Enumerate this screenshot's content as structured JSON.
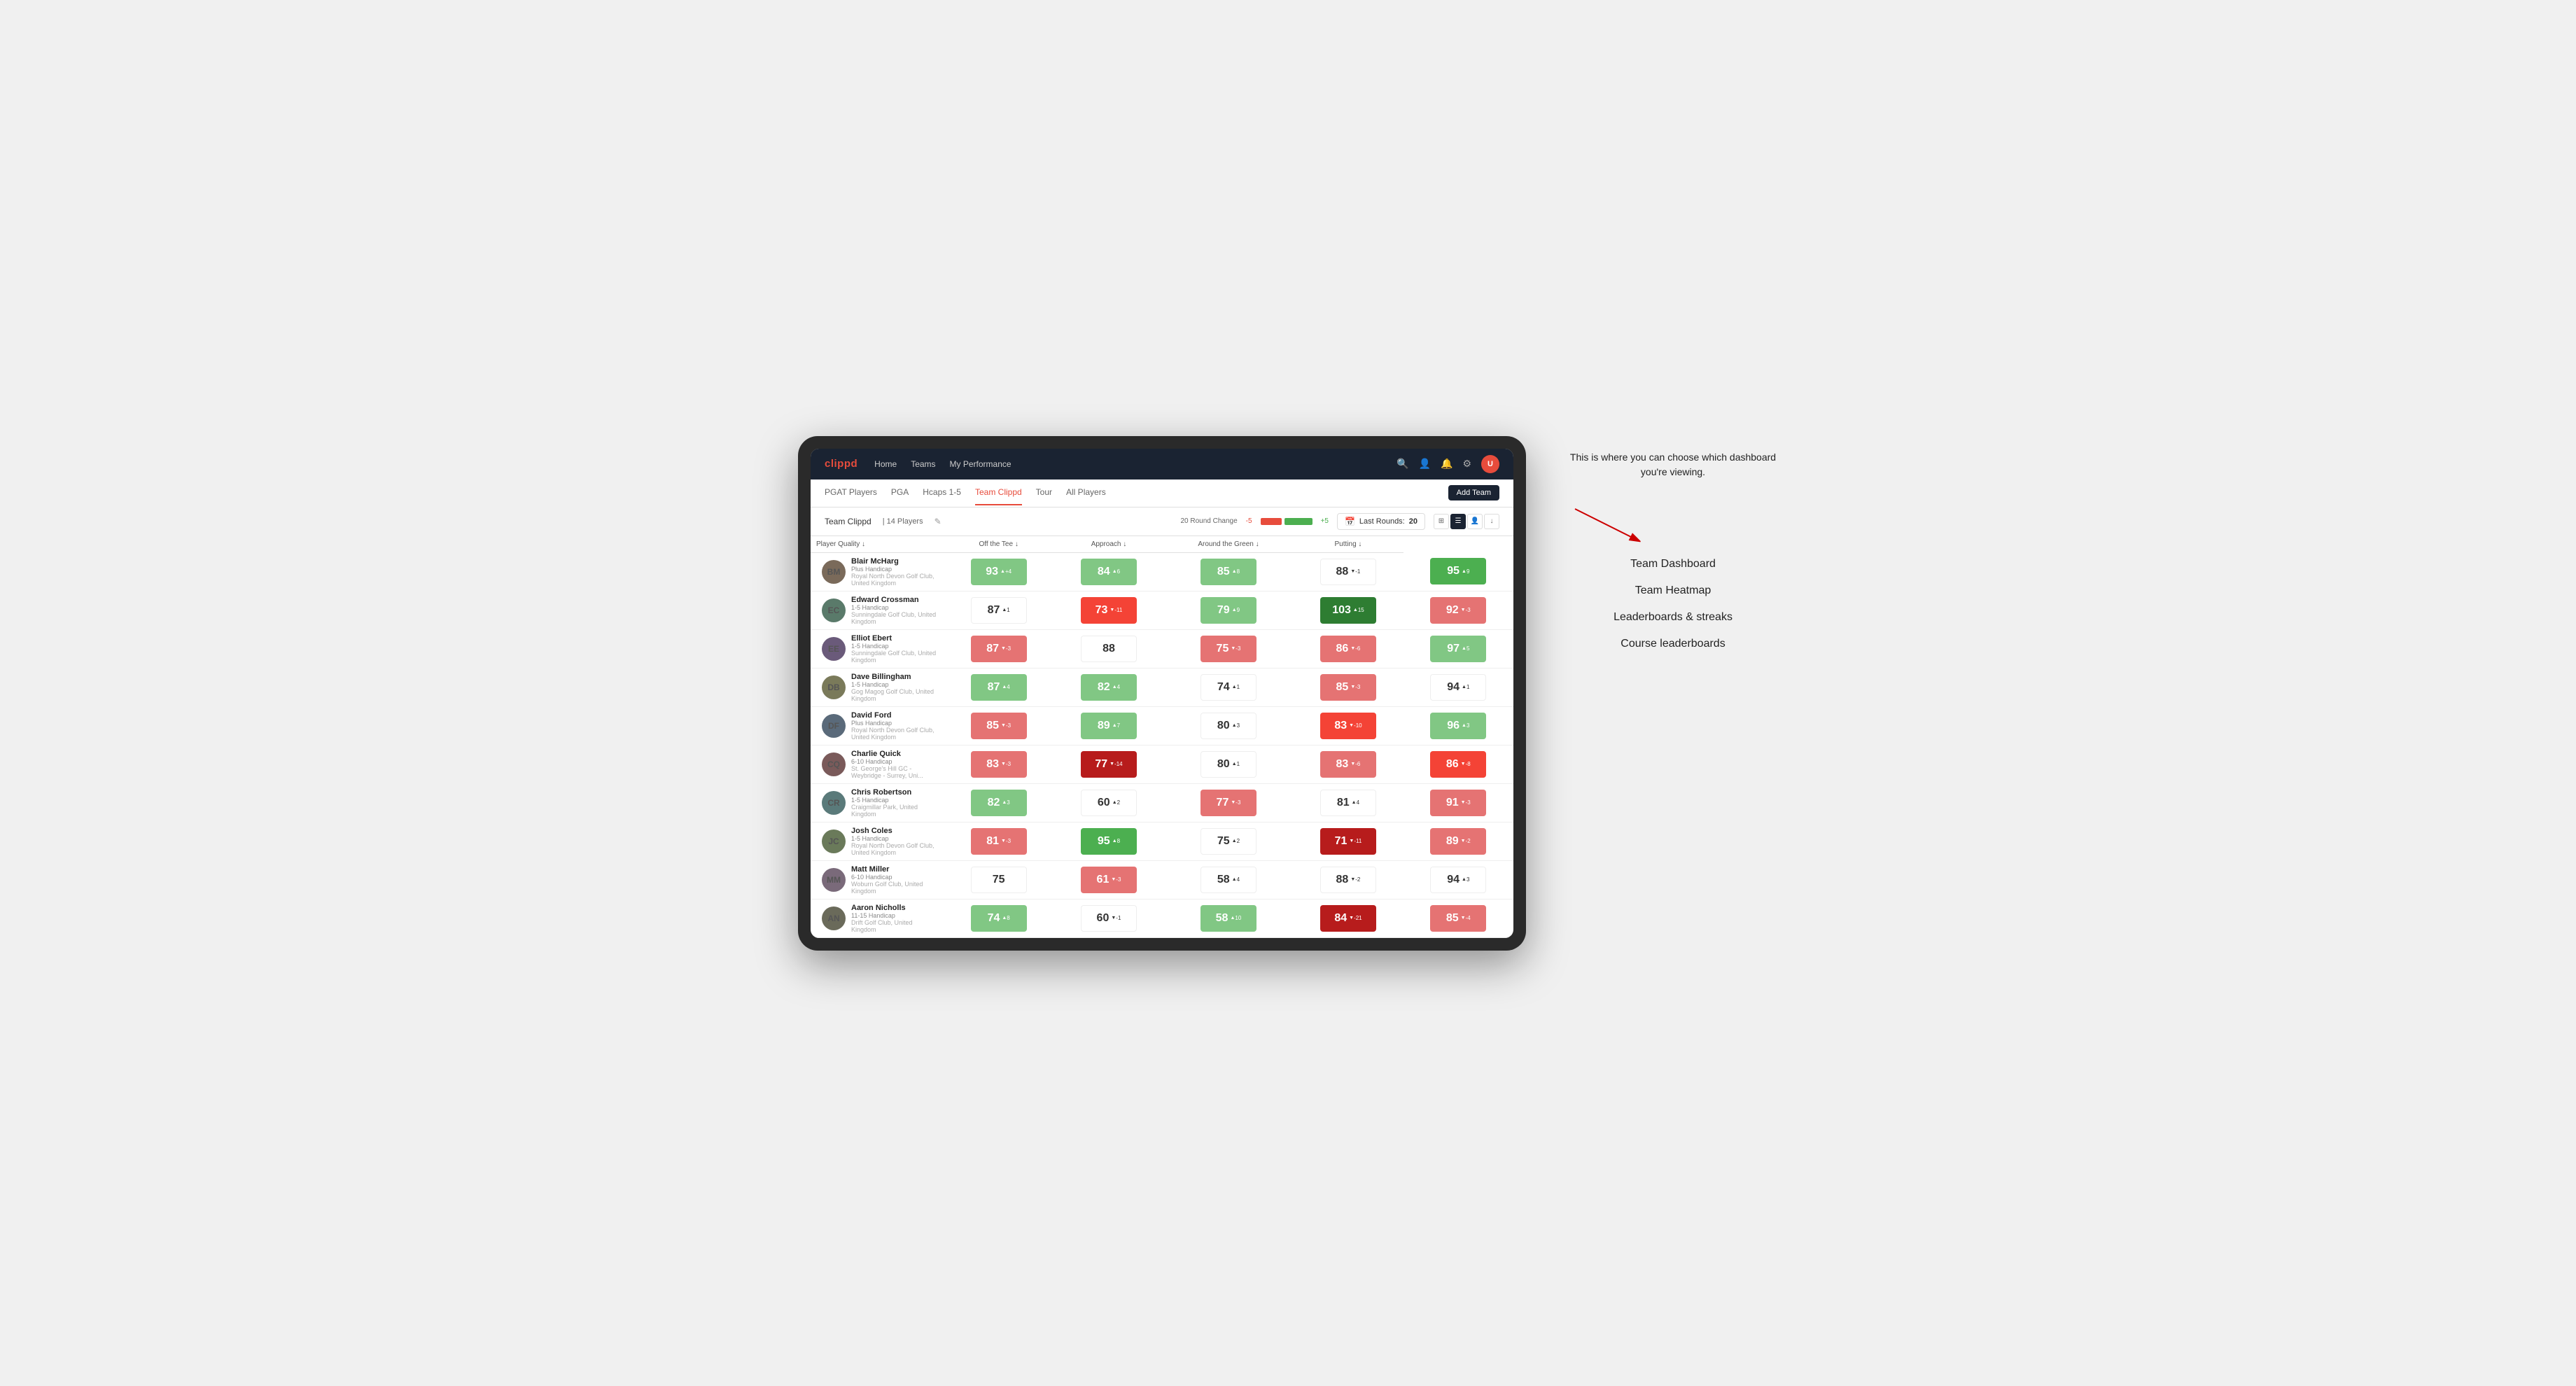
{
  "brand": "clippd",
  "navbar": {
    "links": [
      "Home",
      "Teams",
      "My Performance"
    ],
    "icons": [
      "search",
      "person",
      "bell",
      "settings",
      "avatar"
    ]
  },
  "subnav": {
    "tabs": [
      "PGAT Players",
      "PGA",
      "Hcaps 1-5",
      "Team Clippd",
      "Tour",
      "All Players"
    ],
    "active_tab": "Team Clippd",
    "add_button": "Add Team"
  },
  "team_header": {
    "team_name": "Team Clippd",
    "separator": "|",
    "player_count": "14 Players",
    "round_change_label": "20 Round Change",
    "change_neg": "-5",
    "change_pos": "+5",
    "last_rounds_label": "Last Rounds:",
    "last_rounds_value": "20"
  },
  "table": {
    "columns": [
      {
        "key": "player",
        "label": "Player Quality ↓",
        "sortable": true
      },
      {
        "key": "off_tee",
        "label": "Off the Tee ↓",
        "sortable": true
      },
      {
        "key": "approach",
        "label": "Approach ↓",
        "sortable": true
      },
      {
        "key": "around_green",
        "label": "Around the Green ↓",
        "sortable": true
      },
      {
        "key": "putting",
        "label": "Putting ↓",
        "sortable": true
      }
    ],
    "rows": [
      {
        "name": "Blair McHarg",
        "handicap": "Plus Handicap",
        "club": "Royal North Devon Golf Club, United Kingdom",
        "avatar_initials": "BM",
        "av_class": "av-1",
        "player_quality": {
          "value": "93",
          "change": "+4",
          "dir": "up",
          "color": "green-light"
        },
        "off_tee": {
          "value": "84",
          "change": "6",
          "dir": "up",
          "color": "green-light"
        },
        "approach": {
          "value": "85",
          "change": "8",
          "dir": "up",
          "color": "green-light"
        },
        "around_green": {
          "value": "88",
          "change": "-1",
          "dir": "down",
          "color": "white"
        },
        "putting": {
          "value": "95",
          "change": "9",
          "dir": "up",
          "color": "green-mid"
        }
      },
      {
        "name": "Edward Crossman",
        "handicap": "1-5 Handicap",
        "club": "Sunningdale Golf Club, United Kingdom",
        "avatar_initials": "EC",
        "av_class": "av-2",
        "player_quality": {
          "value": "87",
          "change": "1",
          "dir": "up",
          "color": "white"
        },
        "off_tee": {
          "value": "73",
          "change": "-11",
          "dir": "down",
          "color": "red-mid"
        },
        "approach": {
          "value": "79",
          "change": "9",
          "dir": "up",
          "color": "green-light"
        },
        "around_green": {
          "value": "103",
          "change": "15",
          "dir": "up",
          "color": "green-dark"
        },
        "putting": {
          "value": "92",
          "change": "-3",
          "dir": "down",
          "color": "red-light"
        }
      },
      {
        "name": "Elliot Ebert",
        "handicap": "1-5 Handicap",
        "club": "Sunningdale Golf Club, United Kingdom",
        "avatar_initials": "EE",
        "av_class": "av-3",
        "player_quality": {
          "value": "87",
          "change": "-3",
          "dir": "down",
          "color": "red-light"
        },
        "off_tee": {
          "value": "88",
          "change": "",
          "dir": "",
          "color": "white"
        },
        "approach": {
          "value": "75",
          "change": "-3",
          "dir": "down",
          "color": "red-light"
        },
        "around_green": {
          "value": "86",
          "change": "-6",
          "dir": "down",
          "color": "red-light"
        },
        "putting": {
          "value": "97",
          "change": "5",
          "dir": "up",
          "color": "green-light"
        }
      },
      {
        "name": "Dave Billingham",
        "handicap": "1-5 Handicap",
        "club": "Gog Magog Golf Club, United Kingdom",
        "avatar_initials": "DB",
        "av_class": "av-4",
        "player_quality": {
          "value": "87",
          "change": "4",
          "dir": "up",
          "color": "green-light"
        },
        "off_tee": {
          "value": "82",
          "change": "4",
          "dir": "up",
          "color": "green-light"
        },
        "approach": {
          "value": "74",
          "change": "1",
          "dir": "up",
          "color": "white"
        },
        "around_green": {
          "value": "85",
          "change": "-3",
          "dir": "down",
          "color": "red-light"
        },
        "putting": {
          "value": "94",
          "change": "1",
          "dir": "up",
          "color": "white"
        }
      },
      {
        "name": "David Ford",
        "handicap": "Plus Handicap",
        "club": "Royal North Devon Golf Club, United Kingdom",
        "avatar_initials": "DF",
        "av_class": "av-5",
        "player_quality": {
          "value": "85",
          "change": "-3",
          "dir": "down",
          "color": "red-light"
        },
        "off_tee": {
          "value": "89",
          "change": "7",
          "dir": "up",
          "color": "green-light"
        },
        "approach": {
          "value": "80",
          "change": "3",
          "dir": "up",
          "color": "white"
        },
        "around_green": {
          "value": "83",
          "change": "-10",
          "dir": "down",
          "color": "red-mid"
        },
        "putting": {
          "value": "96",
          "change": "3",
          "dir": "up",
          "color": "green-light"
        }
      },
      {
        "name": "Charlie Quick",
        "handicap": "6-10 Handicap",
        "club": "St. George's Hill GC - Weybridge - Surrey, Uni...",
        "avatar_initials": "CQ",
        "av_class": "av-6",
        "player_quality": {
          "value": "83",
          "change": "-3",
          "dir": "down",
          "color": "red-light"
        },
        "off_tee": {
          "value": "77",
          "change": "-14",
          "dir": "down",
          "color": "red-dark"
        },
        "approach": {
          "value": "80",
          "change": "1",
          "dir": "up",
          "color": "white"
        },
        "around_green": {
          "value": "83",
          "change": "-6",
          "dir": "down",
          "color": "red-light"
        },
        "putting": {
          "value": "86",
          "change": "-8",
          "dir": "down",
          "color": "red-mid"
        }
      },
      {
        "name": "Chris Robertson",
        "handicap": "1-5 Handicap",
        "club": "Craigmillar Park, United Kingdom",
        "avatar_initials": "CR",
        "av_class": "av-7",
        "player_quality": {
          "value": "82",
          "change": "3",
          "dir": "up",
          "color": "green-light"
        },
        "off_tee": {
          "value": "60",
          "change": "2",
          "dir": "up",
          "color": "white"
        },
        "approach": {
          "value": "77",
          "change": "-3",
          "dir": "down",
          "color": "red-light"
        },
        "around_green": {
          "value": "81",
          "change": "4",
          "dir": "up",
          "color": "white"
        },
        "putting": {
          "value": "91",
          "change": "-3",
          "dir": "down",
          "color": "red-light"
        }
      },
      {
        "name": "Josh Coles",
        "handicap": "1-5 Handicap",
        "club": "Royal North Devon Golf Club, United Kingdom",
        "avatar_initials": "JC",
        "av_class": "av-8",
        "player_quality": {
          "value": "81",
          "change": "-3",
          "dir": "down",
          "color": "red-light"
        },
        "off_tee": {
          "value": "95",
          "change": "8",
          "dir": "up",
          "color": "green-mid"
        },
        "approach": {
          "value": "75",
          "change": "2",
          "dir": "up",
          "color": "white"
        },
        "around_green": {
          "value": "71",
          "change": "-11",
          "dir": "down",
          "color": "red-dark"
        },
        "putting": {
          "value": "89",
          "change": "-2",
          "dir": "down",
          "color": "red-light"
        }
      },
      {
        "name": "Matt Miller",
        "handicap": "6-10 Handicap",
        "club": "Woburn Golf Club, United Kingdom",
        "avatar_initials": "MM",
        "av_class": "av-9",
        "player_quality": {
          "value": "75",
          "change": "",
          "dir": "",
          "color": "white"
        },
        "off_tee": {
          "value": "61",
          "change": "-3",
          "dir": "down",
          "color": "red-light"
        },
        "approach": {
          "value": "58",
          "change": "4",
          "dir": "up",
          "color": "white"
        },
        "around_green": {
          "value": "88",
          "change": "-2",
          "dir": "down",
          "color": "white"
        },
        "putting": {
          "value": "94",
          "change": "3",
          "dir": "up",
          "color": "white"
        }
      },
      {
        "name": "Aaron Nicholls",
        "handicap": "11-15 Handicap",
        "club": "Drift Golf Club, United Kingdom",
        "avatar_initials": "AN",
        "av_class": "av-10",
        "player_quality": {
          "value": "74",
          "change": "8",
          "dir": "up",
          "color": "green-light"
        },
        "off_tee": {
          "value": "60",
          "change": "-1",
          "dir": "down",
          "color": "white"
        },
        "approach": {
          "value": "58",
          "change": "10",
          "dir": "up",
          "color": "green-light"
        },
        "around_green": {
          "value": "84",
          "change": "-21",
          "dir": "down",
          "color": "red-dark"
        },
        "putting": {
          "value": "85",
          "change": "-4",
          "dir": "down",
          "color": "red-light"
        }
      }
    ]
  },
  "annotation": {
    "callout": "This is where you can choose which dashboard you're viewing.",
    "items": [
      "Team Dashboard",
      "Team Heatmap",
      "Leaderboards & streaks",
      "Course leaderboards"
    ]
  }
}
